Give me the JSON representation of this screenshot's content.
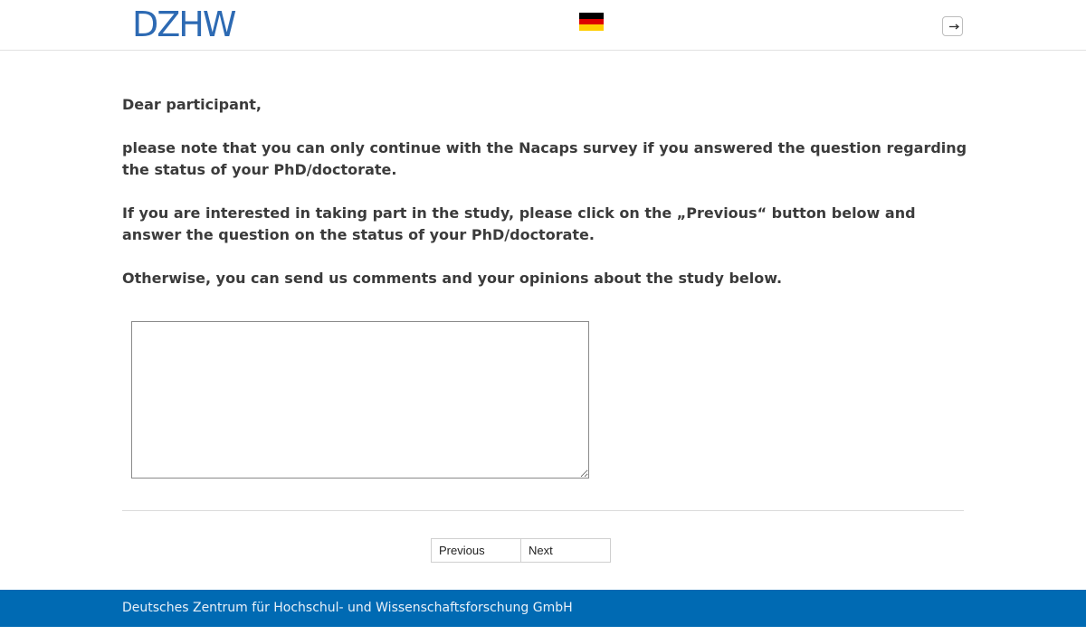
{
  "header": {
    "logo_text": "DZHW",
    "flag_colors": [
      "#000000",
      "#dd0000",
      "#ffce00"
    ],
    "language_flag": "german-flag-icon",
    "logout_icon": "logout-icon"
  },
  "main": {
    "greeting": "Dear participant,",
    "paragraph1": "please note that you can only continue with the Nacaps survey if you answered the question regarding the status of your PhD/doctorate.",
    "paragraph2": "If you are interested in taking part in the study, please click on the „„Previous“ button below and answer the question on the status of your PhD/doctorate.",
    "paragraph3": "Otherwise, you can send us comments and your opinions about the study below.",
    "comment_value": ""
  },
  "navigation": {
    "previous_label": "Previous",
    "next_label": "Next"
  },
  "footer": {
    "text": "Deutsches Zentrum für Hochschul- und Wissenschaftsforschung GmbH",
    "background": "#006ab3"
  }
}
